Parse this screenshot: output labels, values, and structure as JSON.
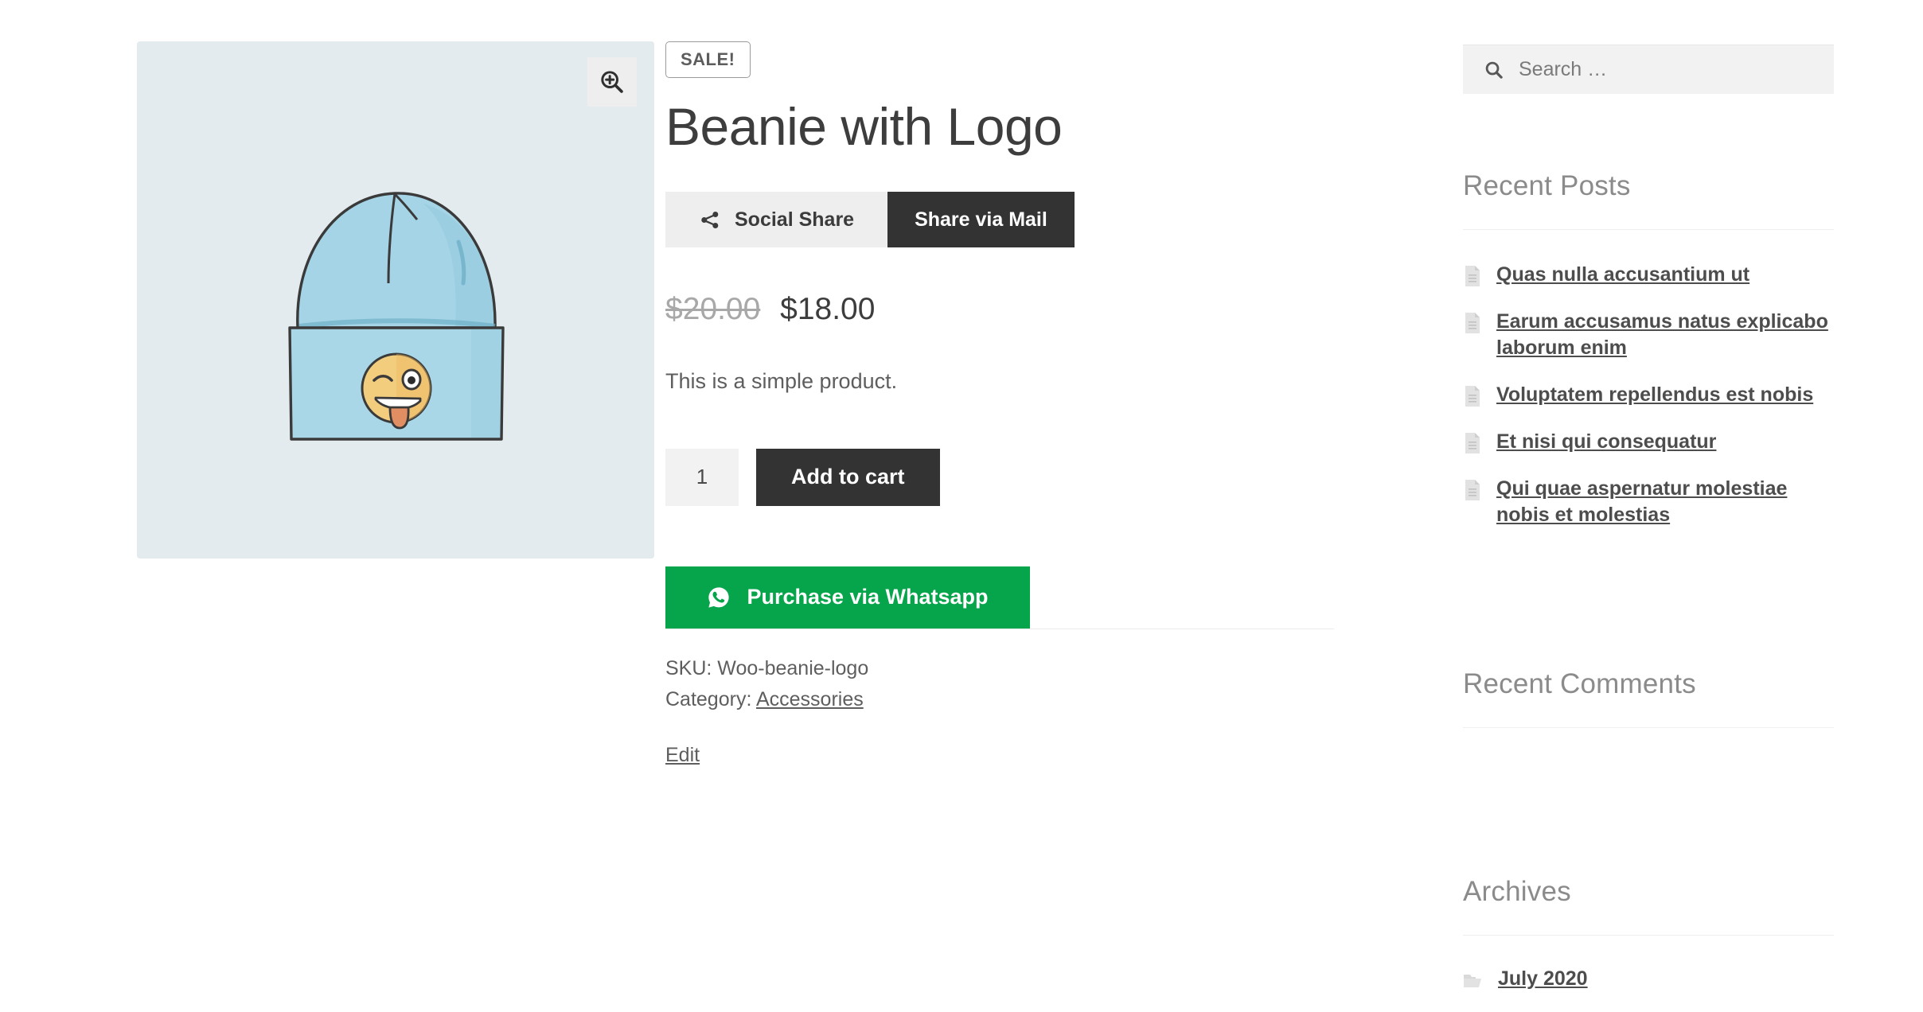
{
  "product": {
    "sale_badge": "SALE!",
    "title": "Beanie with Logo",
    "price_old": "$20.00",
    "price_new": "$18.00",
    "short_description": "This is a simple product.",
    "quantity_value": "1",
    "sku_line": "SKU: Woo-beanie-logo",
    "category_label": "Category:",
    "category_name": "Accessories",
    "edit_label": "Edit",
    "image_alt": "beanie-with-logo",
    "zoom_icon": "magnifier-plus-icon"
  },
  "buttons": {
    "social_share": "Social Share",
    "share_via_mail": "Share via Mail",
    "add_to_cart": "Add to cart",
    "whatsapp": "Purchase via Whatsapp",
    "share_icon": "share-nodes-icon",
    "whatsapp_icon": "whatsapp-icon"
  },
  "sidebar": {
    "search": {
      "placeholder": "Search …",
      "value": "",
      "icon": "search-icon"
    },
    "recent_posts": {
      "title": "Recent Posts",
      "item_icon": "document-icon",
      "items": [
        "Quas nulla accusantium ut",
        "Earum accusamus natus explicabo laborum enim",
        "Voluptatem repellendus est nobis",
        "Et nisi qui consequatur",
        "Qui quae aspernatur molestiae nobis et molestias"
      ]
    },
    "recent_comments": {
      "title": "Recent Comments",
      "items": []
    },
    "archives": {
      "title": "Archives",
      "item_icon": "folder-icon",
      "items": [
        "July 2020"
      ]
    }
  },
  "colors": {
    "accent_dark": "#333333",
    "whatsapp_green": "#06a44b",
    "gallery_bg": "#e4ebee",
    "muted_text": "#8b8b8b"
  }
}
